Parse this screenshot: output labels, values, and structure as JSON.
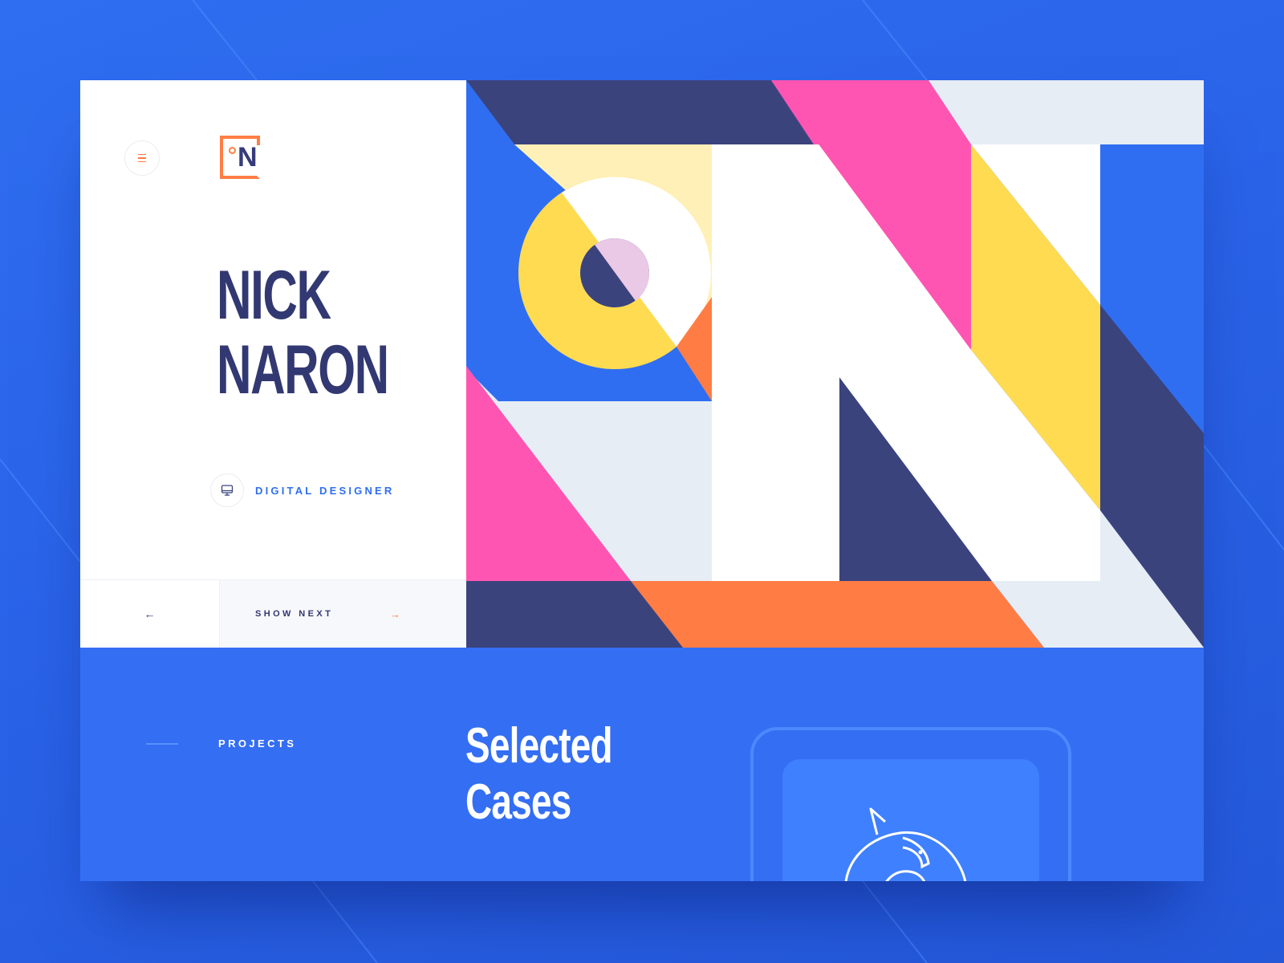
{
  "app": {
    "logo_letter": "N",
    "name_lines": [
      "NICK",
      "NARON"
    ],
    "role": "DIGITAL DESIGNER"
  },
  "icons": {
    "menu": "hamburger-menu-icon",
    "role": "monitor-icon",
    "prev": "arrow-left-icon",
    "next": "arrow-right-icon",
    "case": "bird-icon"
  },
  "navigation": {
    "prev_arrow": "←",
    "next_label": "SHOW NEXT",
    "next_arrow": "→"
  },
  "projects": {
    "label": "PROJECTS",
    "title_lines": [
      "Selected",
      "Cases"
    ]
  },
  "colors": {
    "background_blue": "#2f6ef0",
    "navy": "#3b437d",
    "pink": "#ff55b2",
    "yellow": "#ffdb52",
    "orange": "#ff7d45",
    "light_gray": "#e6edf5",
    "cream": "#fff0b8",
    "lavender": "#e9c9e6"
  }
}
